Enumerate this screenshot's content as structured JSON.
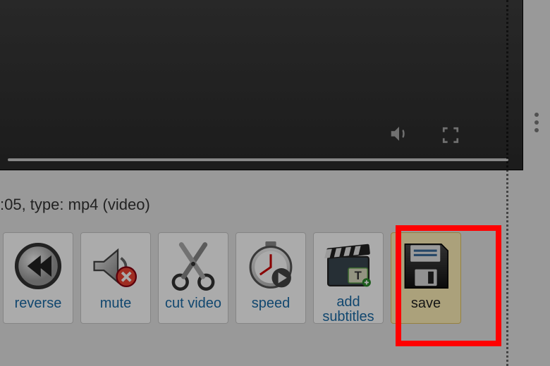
{
  "video_info": {
    "left_fragment": ":05, type: mp4 (video)"
  },
  "toolbar": {
    "reverse": {
      "label": "reverse"
    },
    "mute": {
      "label": "mute"
    },
    "cut": {
      "label": "cut video"
    },
    "speed": {
      "label": "speed"
    },
    "subtitles": {
      "label": "add subtitles"
    },
    "save": {
      "label": "save"
    }
  },
  "icons": {
    "volume": "volume-icon",
    "fullscreen": "fullscreen-icon",
    "more": "more-icon",
    "reverse": "rewind-icon",
    "mute": "speaker-mute-icon",
    "cut": "scissors-icon",
    "speed": "stopwatch-play-icon",
    "subtitles": "clapperboard-subtitle-icon",
    "save": "floppy-disk-icon"
  },
  "colors": {
    "highlight": "#ff0000"
  }
}
